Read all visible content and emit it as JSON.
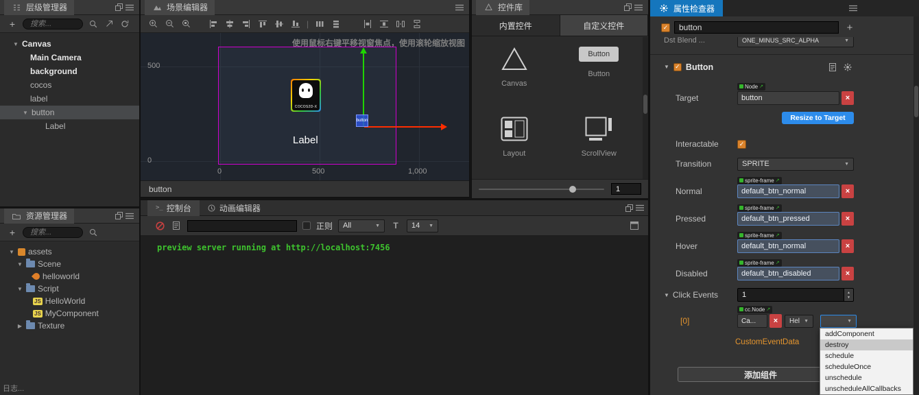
{
  "icons": {
    "plus": "+",
    "caret_down": "▼",
    "caret_right": "▶",
    "caret_up": "▲",
    "close": "×",
    "check": "✓",
    "external": "↗",
    "prompt": ">_",
    "font_size": "T"
  },
  "hierarchy": {
    "tab": "层级管理器",
    "search_placeholder": "搜索...",
    "tree": [
      {
        "label": "Canvas"
      },
      {
        "label": "Main Camera"
      },
      {
        "label": "background"
      },
      {
        "label": "cocos"
      },
      {
        "label": "label"
      },
      {
        "label": "button"
      },
      {
        "label": "Label"
      }
    ]
  },
  "assets": {
    "tab": "资源管理器",
    "search_placeholder": "搜索...",
    "tree": [
      {
        "label": "assets"
      },
      {
        "label": "Scene"
      },
      {
        "label": "helloworld"
      },
      {
        "label": "Script"
      },
      {
        "label": "HelloWorld",
        "badge": "JS"
      },
      {
        "label": "MyComponent",
        "badge": "JS"
      },
      {
        "label": "Texture"
      }
    ]
  },
  "scene": {
    "tab": "场景编辑器",
    "hint": "使用鼠标右键平移视窗焦点，使用滚轮缩放视图",
    "ruler_left": [
      "500",
      "0"
    ],
    "ruler_bottom": [
      "0",
      "500",
      "1,000"
    ],
    "sprite_text": "COCOS2D-X",
    "label_text": "Label",
    "gizmo_tag": "button",
    "status": "button"
  },
  "console": {
    "tab": "控制台",
    "animation_tab": "动画编辑器",
    "regex_label": "正则",
    "filter_value": "All",
    "font_size_value": "14",
    "log_line": "preview server running at http://localhost:7456"
  },
  "library": {
    "tab": "控件库",
    "tab_builtin": "内置控件",
    "tab_custom": "自定义控件",
    "items": [
      {
        "label": "Canvas"
      },
      {
        "label": "Button",
        "preview": "Button"
      },
      {
        "label": "Layout"
      },
      {
        "label": "ScrollView"
      }
    ],
    "zoom_value": "1"
  },
  "inspector": {
    "tab": "属性检查器",
    "node_name": "button",
    "blend_label": "Dst Blend ...",
    "blend_value": "ONE_MINUS_SRC_ALPHA",
    "component_name": "Button",
    "target_label": "Target",
    "target_badge": "Node",
    "target_value": "button",
    "resize_button": "Resize to Target",
    "interactable_label": "Interactable",
    "transition_label": "Transition",
    "transition_value": "SPRITE",
    "sprite_badge": "sprite-frame",
    "states": [
      {
        "label": "Normal",
        "value": "default_btn_normal"
      },
      {
        "label": "Pressed",
        "value": "default_btn_pressed"
      },
      {
        "label": "Hover",
        "value": "default_btn_normal"
      },
      {
        "label": "Disabled",
        "value": "default_btn_disabled"
      }
    ],
    "click_events_label": "Click Events",
    "click_events_count": "1",
    "event_index": "[0]",
    "event_badge": "cc.Node",
    "event_target_value": "Ca...",
    "event_component_value": "Hel",
    "custom_event_label": "CustomEventData",
    "method_menu": [
      "addComponent",
      "destroy",
      "schedule",
      "scheduleOnce",
      "unschedule",
      "unscheduleAllCallbacks"
    ],
    "add_component_label": "添加组件"
  },
  "statusbar": {
    "text": "日志..."
  }
}
